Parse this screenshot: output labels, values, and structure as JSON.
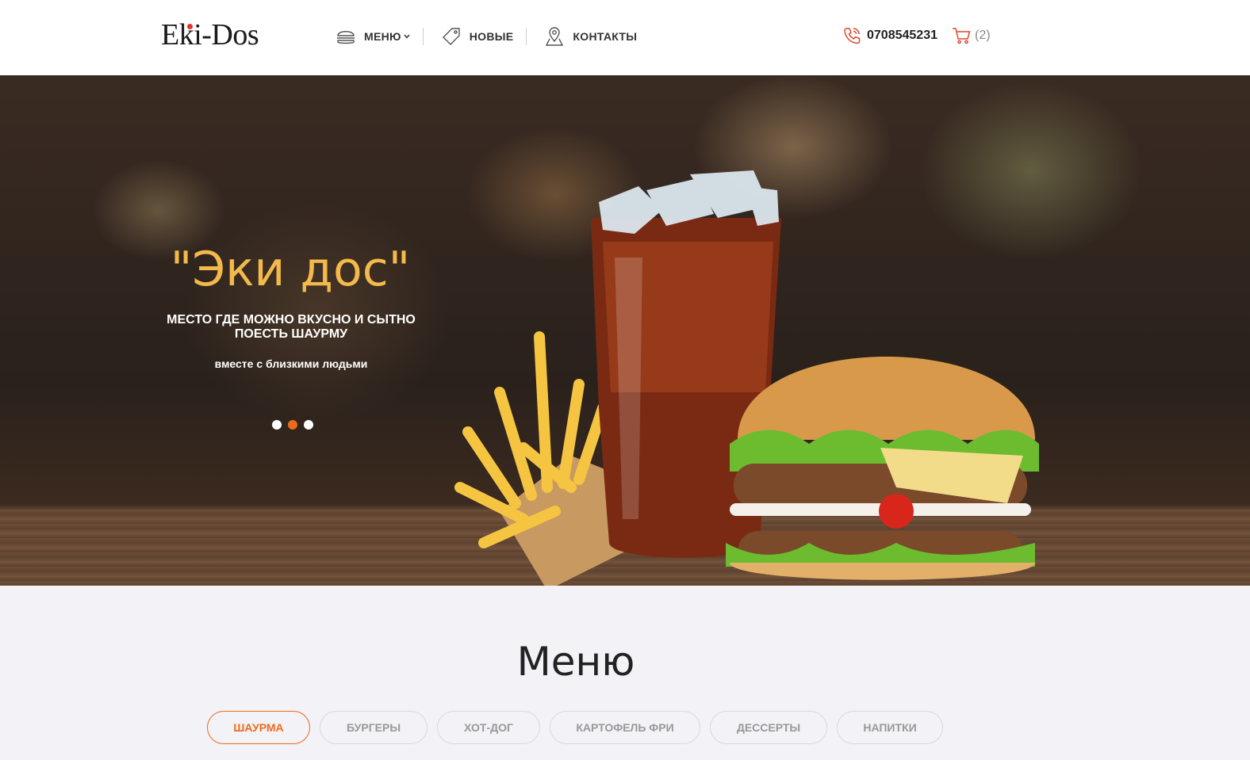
{
  "header": {
    "logo": "Eki-Dos",
    "nav": [
      {
        "label": "МЕНЮ",
        "icon": "burger-icon"
      },
      {
        "label": "НОВЫЕ",
        "icon": "tag-icon"
      },
      {
        "label": "КОНТАКТЫ",
        "icon": "map-pin-icon"
      }
    ],
    "phone": "0708545231",
    "cart_count": "(2)"
  },
  "hero": {
    "title": "\"Эки дос\"",
    "subtitle": "МЕСТО ГДЕ МОЖНО ВКУСНО И СЫТНО ПОЕСТЬ ШАУРМУ",
    "tagline": "вместе с близкими людьми",
    "slides": 3,
    "active_slide": 2
  },
  "menu": {
    "title": "Меню",
    "tabs": [
      "ШАУРМА",
      "БУРГЕРЫ",
      "ХОТ-ДОГ",
      "КАРТОФЕЛЬ ФРИ",
      "ДЕССЕРТЫ",
      "НАПИТКИ"
    ],
    "active_tab": "ШАУРМА"
  },
  "colors": {
    "accent": "#f06a1b",
    "hero_title": "#f3b94a"
  }
}
